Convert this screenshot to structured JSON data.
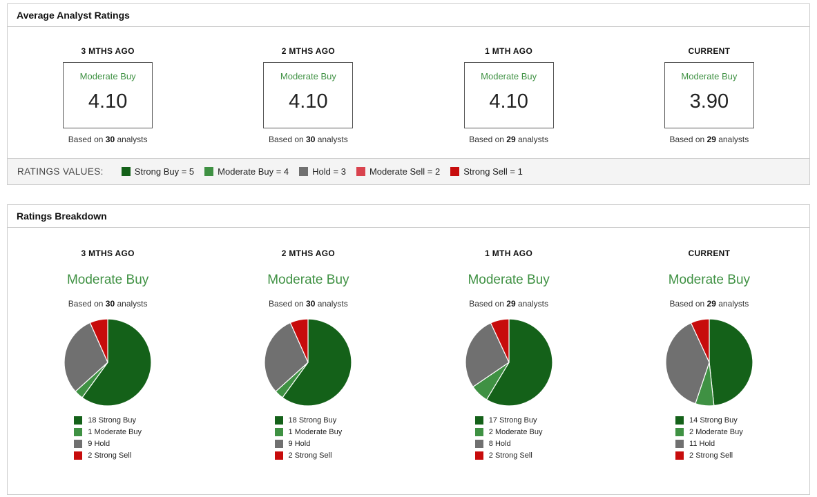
{
  "colors": {
    "strong_buy": "#146119",
    "moderate_buy": "#3f9143",
    "hold": "#707070",
    "moderate_sell": "#d9434e",
    "strong_sell": "#c70c0c",
    "rating_text_green": "#3f9143"
  },
  "average_panel": {
    "title": "Average Analyst Ratings",
    "legend_label": "RATINGS VALUES:",
    "legend": [
      {
        "label": "Strong Buy = 5",
        "color": "#146119"
      },
      {
        "label": "Moderate Buy = 4",
        "color": "#3f9143"
      },
      {
        "label": "Hold = 3",
        "color": "#707070"
      },
      {
        "label": "Moderate Sell = 2",
        "color": "#d9434e"
      },
      {
        "label": "Strong Sell = 1",
        "color": "#c70c0c"
      }
    ],
    "columns": [
      {
        "period": "3 MTHS AGO",
        "rating": "Moderate Buy",
        "value": "4.10",
        "based_prefix": "Based on",
        "analyst_count": "30",
        "based_suffix": "analysts"
      },
      {
        "period": "2 MTHS AGO",
        "rating": "Moderate Buy",
        "value": "4.10",
        "based_prefix": "Based on",
        "analyst_count": "30",
        "based_suffix": "analysts"
      },
      {
        "period": "1 MTH AGO",
        "rating": "Moderate Buy",
        "value": "4.10",
        "based_prefix": "Based on",
        "analyst_count": "29",
        "based_suffix": "analysts"
      },
      {
        "period": "CURRENT",
        "rating": "Moderate Buy",
        "value": "3.90",
        "based_prefix": "Based on",
        "analyst_count": "29",
        "based_suffix": "analysts"
      }
    ]
  },
  "breakdown_panel": {
    "title": "Ratings Breakdown",
    "columns": [
      {
        "period": "3 MTHS AGO",
        "rating": "Moderate Buy",
        "based_prefix": "Based on",
        "analyst_count": "30",
        "based_suffix": "analysts",
        "slices": [
          {
            "label": "18 Strong Buy",
            "value": 18,
            "color": "#146119"
          },
          {
            "label": "1 Moderate Buy",
            "value": 1,
            "color": "#3f9143"
          },
          {
            "label": "9 Hold",
            "value": 9,
            "color": "#707070"
          },
          {
            "label": "2 Strong Sell",
            "value": 2,
            "color": "#c70c0c"
          }
        ]
      },
      {
        "period": "2 MTHS AGO",
        "rating": "Moderate Buy",
        "based_prefix": "Based on",
        "analyst_count": "30",
        "based_suffix": "analysts",
        "slices": [
          {
            "label": "18 Strong Buy",
            "value": 18,
            "color": "#146119"
          },
          {
            "label": "1 Moderate Buy",
            "value": 1,
            "color": "#3f9143"
          },
          {
            "label": "9 Hold",
            "value": 9,
            "color": "#707070"
          },
          {
            "label": "2 Strong Sell",
            "value": 2,
            "color": "#c70c0c"
          }
        ]
      },
      {
        "period": "1 MTH AGO",
        "rating": "Moderate Buy",
        "based_prefix": "Based on",
        "analyst_count": "29",
        "based_suffix": "analysts",
        "slices": [
          {
            "label": "17 Strong Buy",
            "value": 17,
            "color": "#146119"
          },
          {
            "label": "2 Moderate Buy",
            "value": 2,
            "color": "#3f9143"
          },
          {
            "label": "8 Hold",
            "value": 8,
            "color": "#707070"
          },
          {
            "label": "2 Strong Sell",
            "value": 2,
            "color": "#c70c0c"
          }
        ]
      },
      {
        "period": "CURRENT",
        "rating": "Moderate Buy",
        "based_prefix": "Based on",
        "analyst_count": "29",
        "based_suffix": "analysts",
        "slices": [
          {
            "label": "14 Strong Buy",
            "value": 14,
            "color": "#146119"
          },
          {
            "label": "2 Moderate Buy",
            "value": 2,
            "color": "#3f9143"
          },
          {
            "label": "11 Hold",
            "value": 11,
            "color": "#707070"
          },
          {
            "label": "2 Strong Sell",
            "value": 2,
            "color": "#c70c0c"
          }
        ]
      }
    ]
  },
  "chart_data": [
    {
      "type": "table",
      "title": "Average Analyst Ratings",
      "categories": [
        "3 MTHS AGO",
        "2 MTHS AGO",
        "1 MTH AGO",
        "CURRENT"
      ],
      "ratings": [
        "Moderate Buy",
        "Moderate Buy",
        "Moderate Buy",
        "Moderate Buy"
      ],
      "values": [
        4.1,
        4.1,
        4.1,
        3.9
      ],
      "analysts": [
        30,
        30,
        29,
        29
      ],
      "scale": {
        "Strong Buy": 5,
        "Moderate Buy": 4,
        "Hold": 3,
        "Moderate Sell": 2,
        "Strong Sell": 1
      }
    },
    {
      "type": "pie",
      "title": "Ratings Breakdown - 3 MTHS AGO",
      "labels": [
        "Strong Buy",
        "Moderate Buy",
        "Hold",
        "Strong Sell"
      ],
      "values": [
        18,
        1,
        9,
        2
      ],
      "total": 30,
      "colors": [
        "#146119",
        "#3f9143",
        "#707070",
        "#c70c0c"
      ],
      "legend_position": "bottom"
    },
    {
      "type": "pie",
      "title": "Ratings Breakdown - 2 MTHS AGO",
      "labels": [
        "Strong Buy",
        "Moderate Buy",
        "Hold",
        "Strong Sell"
      ],
      "values": [
        18,
        1,
        9,
        2
      ],
      "total": 30,
      "colors": [
        "#146119",
        "#3f9143",
        "#707070",
        "#c70c0c"
      ],
      "legend_position": "bottom"
    },
    {
      "type": "pie",
      "title": "Ratings Breakdown - 1 MTH AGO",
      "labels": [
        "Strong Buy",
        "Moderate Buy",
        "Hold",
        "Strong Sell"
      ],
      "values": [
        17,
        2,
        8,
        2
      ],
      "total": 29,
      "colors": [
        "#146119",
        "#3f9143",
        "#707070",
        "#c70c0c"
      ],
      "legend_position": "bottom"
    },
    {
      "type": "pie",
      "title": "Ratings Breakdown - CURRENT",
      "labels": [
        "Strong Buy",
        "Moderate Buy",
        "Hold",
        "Strong Sell"
      ],
      "values": [
        14,
        2,
        11,
        2
      ],
      "total": 29,
      "colors": [
        "#146119",
        "#3f9143",
        "#707070",
        "#c70c0c"
      ],
      "legend_position": "bottom"
    }
  ]
}
